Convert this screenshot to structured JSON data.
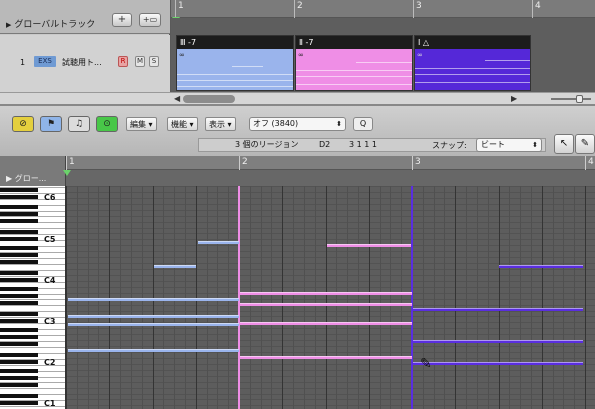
{
  "arrange": {
    "global_track_label": "グローバルトラック",
    "add_track_symbol": "+",
    "add_folder_symbol": "+▭",
    "track": {
      "number": "1",
      "type_badge": "EXS",
      "name": "試聴用ト...",
      "rec": "R",
      "mute": "M",
      "solo": "S"
    },
    "ruler": [
      "1",
      "2",
      "3",
      "4"
    ],
    "regions": [
      {
        "label": "Ⅲ -7",
        "color": "#9ab4ec"
      },
      {
        "label": "Ⅱ -7",
        "color": "#ef8ee6"
      },
      {
        "label": "Ⅰ △",
        "color": "#5528d8"
      }
    ]
  },
  "toolbar": {
    "menus": [
      "編集",
      "機能",
      "表示"
    ],
    "quantize": "オフ (3840)",
    "find_symbol": "Q",
    "region_count": "3 個のリージョン",
    "pitch": "D2",
    "position": "3 1 1 1",
    "snap_label": "スナップ:",
    "snap_value": "ビート",
    "pointer_tool": "↖",
    "pencil_tool": "✎"
  },
  "piano_roll": {
    "global_label": "グロー...",
    "ruler": [
      "1",
      "2",
      "3",
      "4"
    ],
    "octave_labels": [
      "C6",
      "C5",
      "C4",
      "C3",
      "C2",
      "C1"
    ],
    "colors": {
      "blue": "#9ab4ec",
      "pink": "#ef8ee6",
      "purple": "#5a2ee0"
    }
  }
}
